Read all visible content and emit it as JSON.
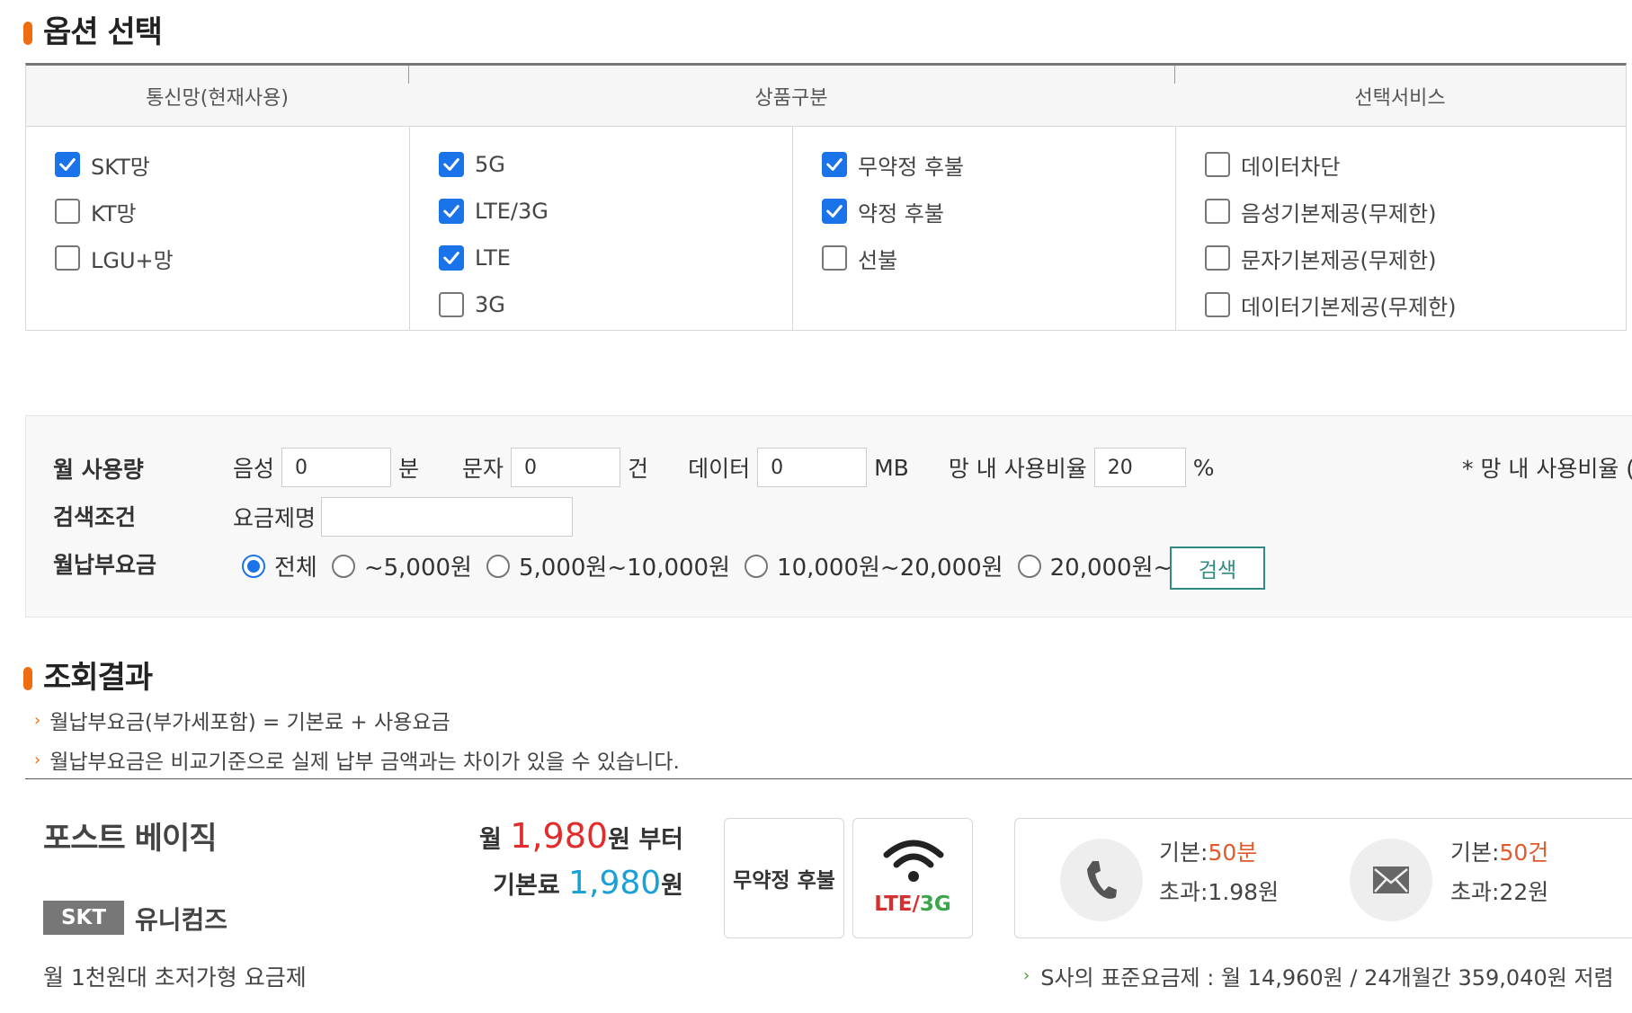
{
  "option_section": {
    "title": "옵션 선택"
  },
  "table_headers": [
    "통신망(현재사용)",
    "상품구분",
    "선택서비스"
  ],
  "network": [
    {
      "label": "SKT망",
      "checked": true
    },
    {
      "label": "KT망",
      "checked": false
    },
    {
      "label": "LGU+망",
      "checked": false
    }
  ],
  "product_tech": [
    {
      "label": "5G",
      "checked": true
    },
    {
      "label": "LTE/3G",
      "checked": true
    },
    {
      "label": "LTE",
      "checked": true
    },
    {
      "label": "3G",
      "checked": false
    }
  ],
  "product_pay": [
    {
      "label": "무약정 후불",
      "checked": true
    },
    {
      "label": "약정 후불",
      "checked": true
    },
    {
      "label": "선불",
      "checked": false
    }
  ],
  "services": [
    {
      "label": "데이터차단",
      "checked": false
    },
    {
      "label": "음성기본제공(무제한)",
      "checked": false
    },
    {
      "label": "문자기본제공(무제한)",
      "checked": false
    },
    {
      "label": "데이터기본제공(무제한)",
      "checked": false
    }
  ],
  "usage": {
    "row_label": "월 사용량",
    "voice_label": "음성",
    "voice_value": "0",
    "voice_unit": "분",
    "sms_label": "문자",
    "sms_value": "0",
    "sms_unit": "건",
    "data_label": "데이터",
    "data_value": "0",
    "data_unit": "MB",
    "ratio_label": "망 내 사용비율",
    "ratio_value": "20",
    "ratio_unit": "%",
    "ratio_note": "* 망 내 사용비율 ("
  },
  "search_cond": {
    "row_label": "검색조건",
    "name_label": "요금제명",
    "name_value": ""
  },
  "fee": {
    "row_label": "월납부요금",
    "options": [
      {
        "label": "전체",
        "selected": true
      },
      {
        "label": "~5,000원",
        "selected": false
      },
      {
        "label": "5,000원~10,000원",
        "selected": false
      },
      {
        "label": "10,000원~20,000원",
        "selected": false
      },
      {
        "label": "20,000원~",
        "selected": false
      }
    ],
    "search_button": "검색"
  },
  "result_section": {
    "title": "조회결과",
    "notes": [
      "월납부요금(부가세포함) = 기본료 + 사용요금",
      "월납부요금은 비교기준으로 실제 납부 금액과는 차이가 있을 수 있습니다."
    ]
  },
  "plan": {
    "name": "포스트 베이직",
    "carrier_badge": "SKT",
    "company": "유니컴즈",
    "desc": "월 1천원대 초저가형 요금제",
    "monthly_prefix": "월 ",
    "monthly_value": "1,980",
    "monthly_suffix": "원 부터",
    "base_prefix": "기본료 ",
    "base_value": "1,980",
    "base_suffix": "원",
    "pay_type": "무약정 후불",
    "network_a": "LTE",
    "network_sep": "/",
    "network_b": "3G",
    "voice_base_label": "기본:",
    "voice_base_value": "50분",
    "voice_over": "초과:1.98원",
    "sms_base_label": "기본:",
    "sms_base_value": "50건",
    "sms_over": "초과:22원",
    "compare_note": "S사의 표준요금제 : 월 14,960원 / 24개월간 359,040원 저렴"
  },
  "colors": {
    "accent": "#ef6c0f",
    "check": "#1a73e8",
    "price_red": "#e22c2c",
    "price_blue": "#1aa0d8",
    "button": "#2e8b82"
  }
}
